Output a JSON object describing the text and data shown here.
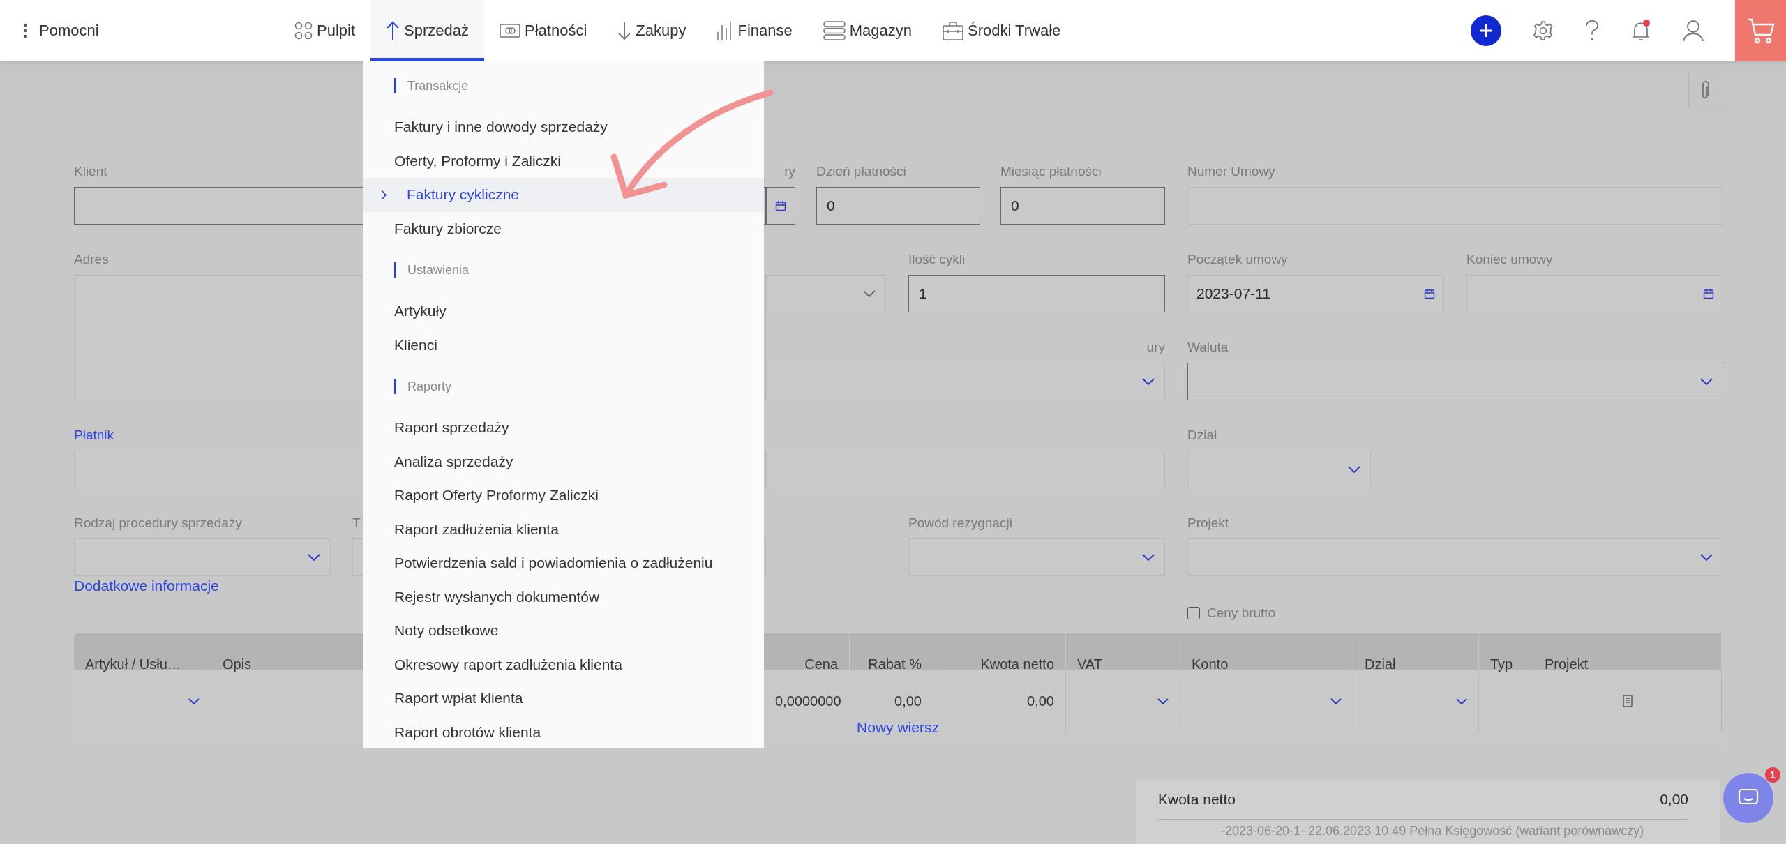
{
  "topbar": {
    "helper": "Pomocni",
    "nav": [
      {
        "label": "Pulpit",
        "selected": false
      },
      {
        "label": "Sprzedaż",
        "selected": true
      },
      {
        "label": "Płatności",
        "selected": false
      },
      {
        "label": "Zakupy",
        "selected": false
      },
      {
        "label": "Finanse",
        "selected": false
      },
      {
        "label": "Magazyn",
        "selected": false
      },
      {
        "label": "Środki Trwałe",
        "selected": false
      }
    ],
    "notifications_unread": true
  },
  "menu": [
    {
      "kind": "header",
      "label": "Transakcje"
    },
    {
      "kind": "item",
      "label": "Faktury i inne dowody sprzedaży",
      "selected": false
    },
    {
      "kind": "item",
      "label": "Oferty, Proformy i Zaliczki",
      "selected": false
    },
    {
      "kind": "item",
      "label": "Faktury cykliczne",
      "selected": true
    },
    {
      "kind": "item",
      "label": "Faktury zbiorcze",
      "selected": false
    },
    {
      "kind": "header",
      "label": "Ustawienia"
    },
    {
      "kind": "item",
      "label": "Artykuły",
      "selected": false
    },
    {
      "kind": "item",
      "label": "Klienci",
      "selected": false
    },
    {
      "kind": "header",
      "label": "Raporty"
    },
    {
      "kind": "item",
      "label": "Raport sprzedaży",
      "selected": false
    },
    {
      "kind": "item",
      "label": "Analiza sprzedaży",
      "selected": false
    },
    {
      "kind": "item",
      "label": "Raport Oferty Proformy Zaliczki",
      "selected": false
    },
    {
      "kind": "item",
      "label": "Raport zadłużenia klienta",
      "selected": false
    },
    {
      "kind": "item",
      "label": "Potwierdzenia sald i powiadomienia o zadłużeniu",
      "selected": false
    },
    {
      "kind": "item",
      "label": "Rejestr wysłanych dokumentów",
      "selected": false
    },
    {
      "kind": "item",
      "label": "Noty odsetkowe",
      "selected": false
    },
    {
      "kind": "item",
      "label": "Okresowy raport zadłużenia klienta",
      "selected": false
    },
    {
      "kind": "item",
      "label": "Raport wpłat klienta",
      "selected": false
    },
    {
      "kind": "item",
      "label": "Raport obrotów klienta",
      "selected": false
    }
  ],
  "fields": [
    {
      "kind": "input",
      "label": "Klient",
      "highlighted": true,
      "label_link": false
    },
    {
      "kind": "date",
      "label": "ry",
      "highlighted": true,
      "label_link": false
    },
    {
      "kind": "input",
      "label": "Dzień płatności",
      "value": "0",
      "highlighted": true,
      "label_link": false
    },
    {
      "kind": "input",
      "label": "Miesiąc płatności",
      "value": "0",
      "highlighted": true,
      "label_link": false
    },
    {
      "kind": "input",
      "label": "Numer Umowy",
      "highlighted": false,
      "label_link": false
    },
    {
      "kind": "textarea",
      "label": "Adres",
      "highlighted": false,
      "label_link": false
    },
    {
      "kind": "select",
      "highlighted": false
    },
    {
      "kind": "input",
      "label": "Ilość cykli",
      "value": "1",
      "highlighted": true,
      "label_link": false
    },
    {
      "kind": "date",
      "label": "Początek umowy",
      "value": "2023-07-11",
      "highlighted": false,
      "label_link": false
    },
    {
      "kind": "date",
      "label": "Koniec umowy",
      "highlighted": false,
      "label_link": false
    },
    {
      "kind": "select",
      "label": "ury",
      "highlighted": false,
      "label_link": false
    },
    {
      "kind": "select",
      "label": "Waluta",
      "highlighted": true,
      "label_link": false
    },
    {
      "kind": "input",
      "label": "Płatnik",
      "highlighted": false,
      "label_link": true
    },
    {
      "kind": "input",
      "highlighted": false
    },
    {
      "kind": "select",
      "label": "Dział",
      "highlighted": false,
      "label_link": false
    },
    {
      "kind": "select",
      "label": "Rodzaj procedury sprzedaży",
      "highlighted": false,
      "label_link": false
    },
    {
      "kind": "input",
      "label": "T",
      "highlighted": false,
      "label_link": false
    },
    {
      "kind": "select",
      "label": "Powód rezygnacji",
      "highlighted": false,
      "label_link": false
    },
    {
      "kind": "select",
      "label": "Projekt",
      "highlighted": false,
      "label_link": false
    }
  ],
  "more_info_link": "Dodatkowe informacje",
  "gross_prices": {
    "label": "Ceny brutto",
    "checked": false
  },
  "table": {
    "columns": [
      "Artykuł / Usłu…",
      "Opis",
      "Cena",
      "Rabat %",
      "Kwota netto",
      "VAT",
      "Konto",
      "Dział",
      "Typ",
      "Projekt"
    ],
    "rows": [
      {
        "cells": [
          {
            "kind": "select"
          },
          {
            "kind": "blank"
          },
          {
            "kind": "text",
            "text": "0,0000000"
          },
          {
            "kind": "text",
            "text": "0,00"
          },
          {
            "kind": "text",
            "text": "0,00"
          },
          {
            "kind": "select"
          },
          {
            "kind": "select"
          },
          {
            "kind": "select"
          },
          {
            "kind": "blank"
          },
          {
            "kind": "document"
          }
        ]
      }
    ],
    "add_row": "Nowy wiersz"
  },
  "summary": {
    "label": "Kwota netto",
    "value": "0,00",
    "footer": "-2023-06-20-1- 22.06.2023 10:49 Pełna Księgowość (wariant porównawczy)"
  },
  "chat": {
    "badge": "1"
  }
}
